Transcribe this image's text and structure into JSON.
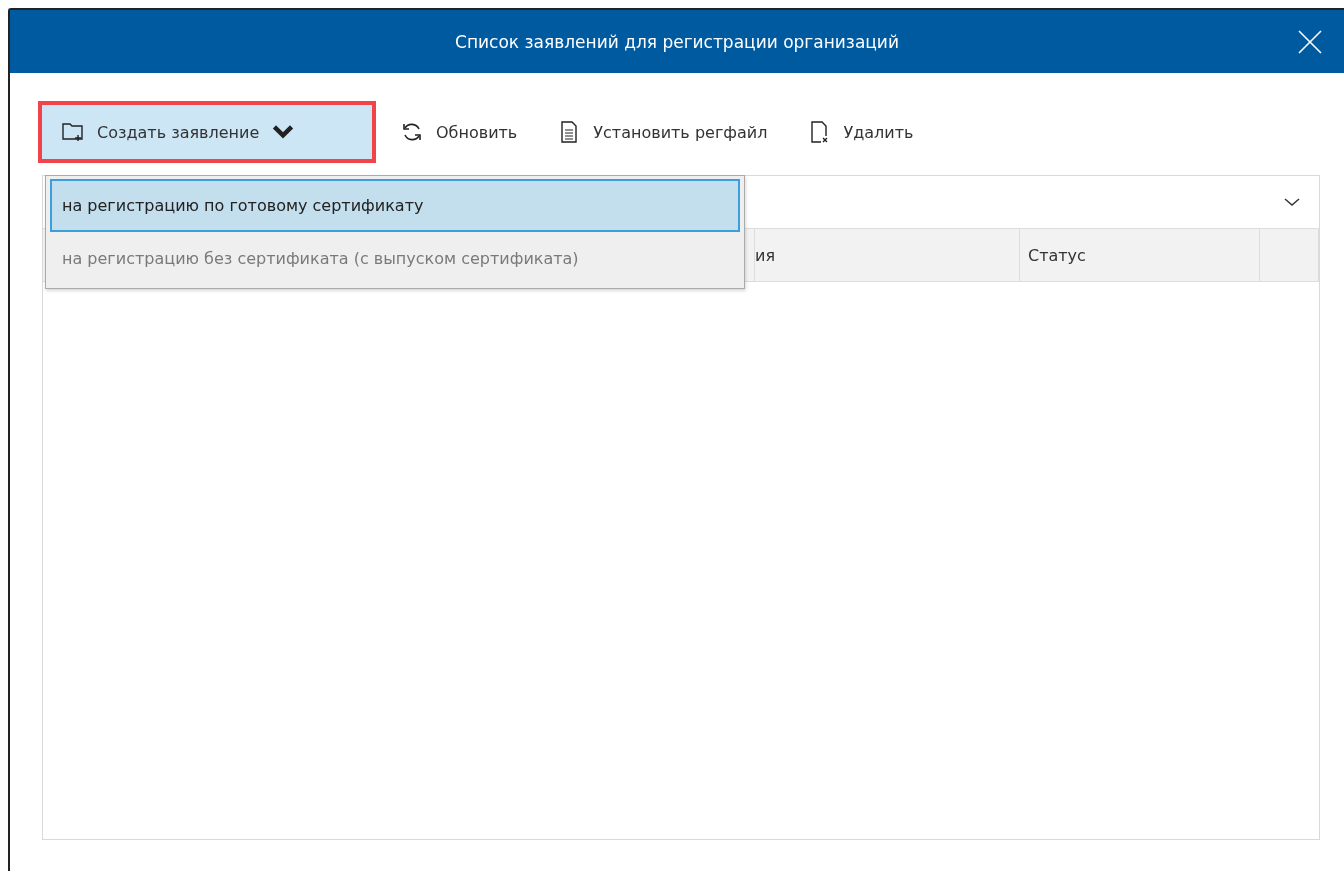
{
  "window": {
    "title": "Список заявлений для регистрации организаций"
  },
  "toolbar": [
    {
      "kind": "dropdown",
      "label": "Создать заявление",
      "highlighted": true,
      "open": true
    },
    {
      "kind": "button",
      "label": "Обновить",
      "highlighted": false
    },
    {
      "kind": "button",
      "label": "Установить регфайл",
      "highlighted": false
    },
    {
      "kind": "button",
      "label": "Удалить",
      "highlighted": false
    }
  ],
  "menu": [
    {
      "label": "на регистрацию по готовому сертификату",
      "selected": true,
      "disabled": false
    },
    {
      "label": "на регистрацию без сертификата (с выпуском сертификата)",
      "selected": false,
      "disabled": true
    }
  ],
  "table": {
    "columns": [
      {
        "label": "ия"
      },
      {
        "label": "Статус"
      }
    ]
  }
}
